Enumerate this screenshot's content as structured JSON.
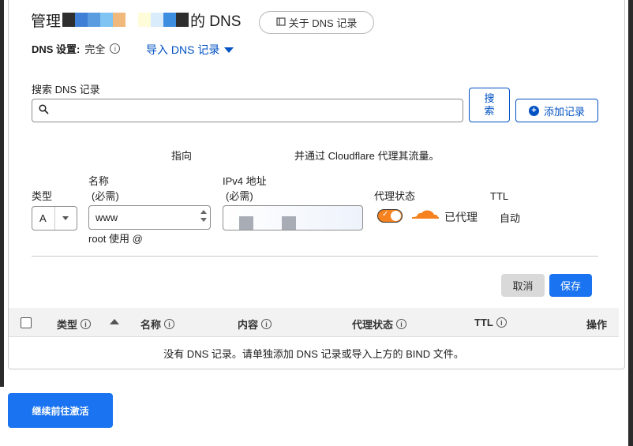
{
  "header": {
    "title_prefix": "管理",
    "title_suffix": "的 DNS",
    "about_button": "关于 DNS 记录",
    "redacted_colors": [
      "#2e2e2e",
      "#3f7fd6",
      "#5b9be0",
      "#7fc4f2",
      "#f0b87a",
      "#ffffff",
      "#fefcd9",
      "#d8ecfb",
      "#3d8de0",
      "#2e2e2e"
    ]
  },
  "settings": {
    "label": "DNS 设置:",
    "value": "完全",
    "import_link": "导入 DNS 记录"
  },
  "search": {
    "label": "搜索 DNS 记录",
    "value": "",
    "search_button": "搜索",
    "add_button": "添加记录"
  },
  "hint": {
    "part1": "指向",
    "part2": "并通过 Cloudflare 代理其流量。"
  },
  "form": {
    "type_label": "类型",
    "type_value": "A",
    "name_label": "名称",
    "name_required": "(必需)",
    "name_value": "www",
    "root_note": "root 使用 @",
    "ipv4_label": "IPv4 地址",
    "ipv4_required": "(必需)",
    "proxy_label": "代理状态",
    "proxy_on": true,
    "proxy_value": "已代理",
    "ttl_label": "TTL",
    "ttl_value": "自动",
    "cancel_button": "取消",
    "save_button": "保存"
  },
  "table": {
    "columns": [
      "类型",
      "名称",
      "内容",
      "代理状态",
      "TTL",
      "操作"
    ],
    "empty_message": "没有 DNS 记录。请单独添加 DNS 记录或导入上方的 BIND 文件。"
  },
  "footer": {
    "continue_button": "继续前往激活"
  },
  "colors": {
    "accent": "#0051c3",
    "primary_button": "#1a73f0",
    "proxy_orange": "#f6821f"
  }
}
